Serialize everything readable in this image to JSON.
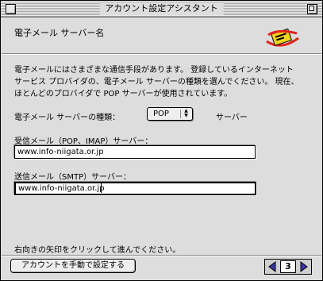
{
  "window": {
    "title": "アカウント設定アシスタント"
  },
  "header": {
    "title": "電子メール サーバー名",
    "icon": "mail-icon"
  },
  "content": {
    "description_lines": [
      "電子メールにはさまざまな通信手段があります。 登録しているインターネット",
      "サービス プロバイダの、電子メール サーバーの種類を選んでください。 現在、",
      "ほとんどのプロバイダで POP サーバーが使用されています。"
    ],
    "server_type_label": "電子メール サーバーの種類：",
    "server_type_value": "POP",
    "server_type_suffix": "サーバー",
    "incoming_label": "受信メール（POP、IMAP）サーバー：",
    "incoming_value": "www.info-niigata.or.jp",
    "outgoing_label": "送信メール（SMTP）サーバー：",
    "outgoing_value": "www.info-niigata.or.jp",
    "hint": "右向きの矢印をクリックして進んでください。"
  },
  "footer": {
    "manual_button": "アカウントを手動で設定する",
    "page_number": "3"
  },
  "colors": {
    "window_bg": "#dddddd",
    "nav_arrow": "#3a35a8",
    "mail_icon_yellow": "#f2d21c",
    "mail_icon_red": "#e0241b"
  }
}
